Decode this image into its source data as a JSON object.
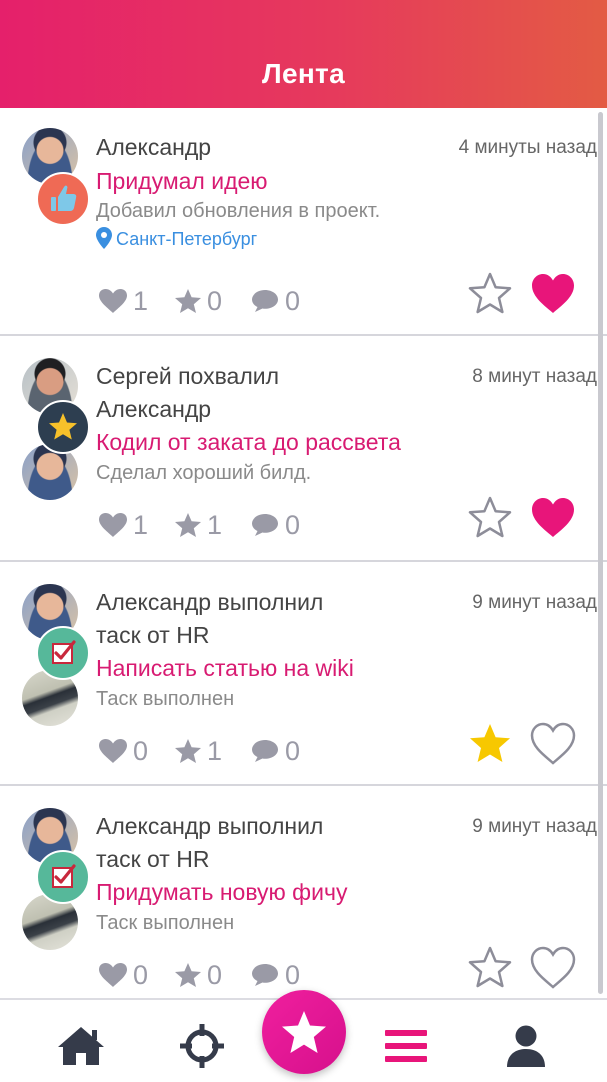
{
  "header": {
    "title": "Лента"
  },
  "feed": [
    {
      "actor": "Александр",
      "time": "4 минуты назад",
      "title": "Придумал идею",
      "description": "Добавил обновления в проект.",
      "location": "Санкт-Петербург",
      "badge_icon": "thumbs-up-icon",
      "likes": "1",
      "stars": "0",
      "comments": "0",
      "starred": false,
      "liked": true
    },
    {
      "actor_line1": "Сергей похвалил",
      "actor_line2": "Александр",
      "time": "8 минут назад",
      "title": "Кодил от заката до рассвета",
      "description": "Сделал хороший билд.",
      "badge_icon": "star-icon",
      "likes": "1",
      "stars": "1",
      "comments": "0",
      "starred": false,
      "liked": true
    },
    {
      "actor_line1": "Александр выполнил",
      "actor_line2": "таск от HR",
      "time": "9 минут назад",
      "title": "Написать статью на wiki",
      "description": "Таск выполнен",
      "badge_icon": "checkbox-icon",
      "likes": "0",
      "stars": "1",
      "comments": "0",
      "starred": true,
      "liked": false
    },
    {
      "actor_line1": "Александр выполнил",
      "actor_line2": "таск от HR",
      "time": "9 минут назад",
      "title": "Придумать новую фичу",
      "description": "Таск выполнен",
      "badge_icon": "checkbox-icon",
      "likes": "0",
      "stars": "0",
      "comments": "0",
      "starred": false,
      "liked": false
    }
  ],
  "colors": {
    "accent": "#d81b72",
    "like_active": "#e8157a",
    "star_active": "#f7c800",
    "muted": "#9a9aa6",
    "location": "#3a8fe0"
  },
  "bottom_nav": {
    "items": [
      "home-icon",
      "crosshair-icon",
      "star-icon",
      "menu-icon",
      "user-icon"
    ],
    "active": "star-icon"
  }
}
